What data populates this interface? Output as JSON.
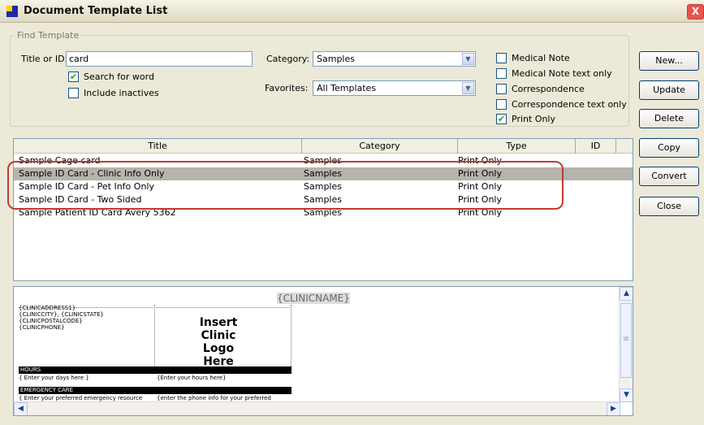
{
  "window": {
    "title": "Document Template List",
    "close_glyph": "X"
  },
  "find": {
    "legend": "Find Template",
    "title_label": "Title or ID:",
    "title_value": "card",
    "search_for_word": "Search for word",
    "include_inactives": "Include inactives",
    "category_label": "Category:",
    "category_value": "Samples",
    "favorites_label": "Favorites:",
    "favorites_value": "All Templates",
    "types": {
      "medical_note": "Medical Note",
      "medical_note_text": "Medical Note text only",
      "correspondence": "Correspondence",
      "correspondence_text": "Correspondence text only",
      "print_only": "Print Only"
    }
  },
  "buttons": {
    "new": "New...",
    "update": "Update",
    "delete": "Delete",
    "copy": "Copy",
    "convert": "Convert",
    "close": "Close"
  },
  "table": {
    "columns": {
      "title": "Title",
      "category": "Category",
      "type": "Type",
      "id": "ID"
    },
    "rows": [
      {
        "title": "Sample Cage card",
        "category": "Samples",
        "type": "Print Only",
        "id": ""
      },
      {
        "title": "Sample ID Card - Clinic Info Only",
        "category": "Samples",
        "type": "Print Only",
        "id": ""
      },
      {
        "title": "Sample ID Card - Pet Info Only",
        "category": "Samples",
        "type": "Print Only",
        "id": ""
      },
      {
        "title": "Sample ID Card - Two Sided",
        "category": "Samples",
        "type": "Print Only",
        "id": ""
      },
      {
        "title": "Sample Patient ID Card Avery 5362",
        "category": "Samples",
        "type": "Print Only",
        "id": ""
      }
    ]
  },
  "preview": {
    "clinic_name": "{CLINICNAME}",
    "address": "{CLINICADDRESS1}",
    "city_state": "{CLINICCITY}, {CLINICSTATE}",
    "postal": "{CLINICPOSTALCODE}",
    "phone": "{CLINICPHONE}",
    "logo": "Insert Clinic Logo Here",
    "hours": "HOURS",
    "days_placeholder": "{ Enter your days here }",
    "hours_placeholder": "{Enter your hours here}",
    "emergency": "EMERGENCY CARE",
    "emergency_resource": "{ Enter your preferred emergency resource",
    "emergency_phone": "{enter the phone info for your preferred"
  },
  "icons": {
    "checkmark": "✔",
    "dropdown": "▼",
    "scroll_up": "▲",
    "scroll_down": "▼",
    "scroll_left": "◀",
    "scroll_right": "▶",
    "scroll_grip": "≡"
  },
  "colors": {
    "selection": "#b7b3ad",
    "highlight_border": "#bf3b2f"
  }
}
